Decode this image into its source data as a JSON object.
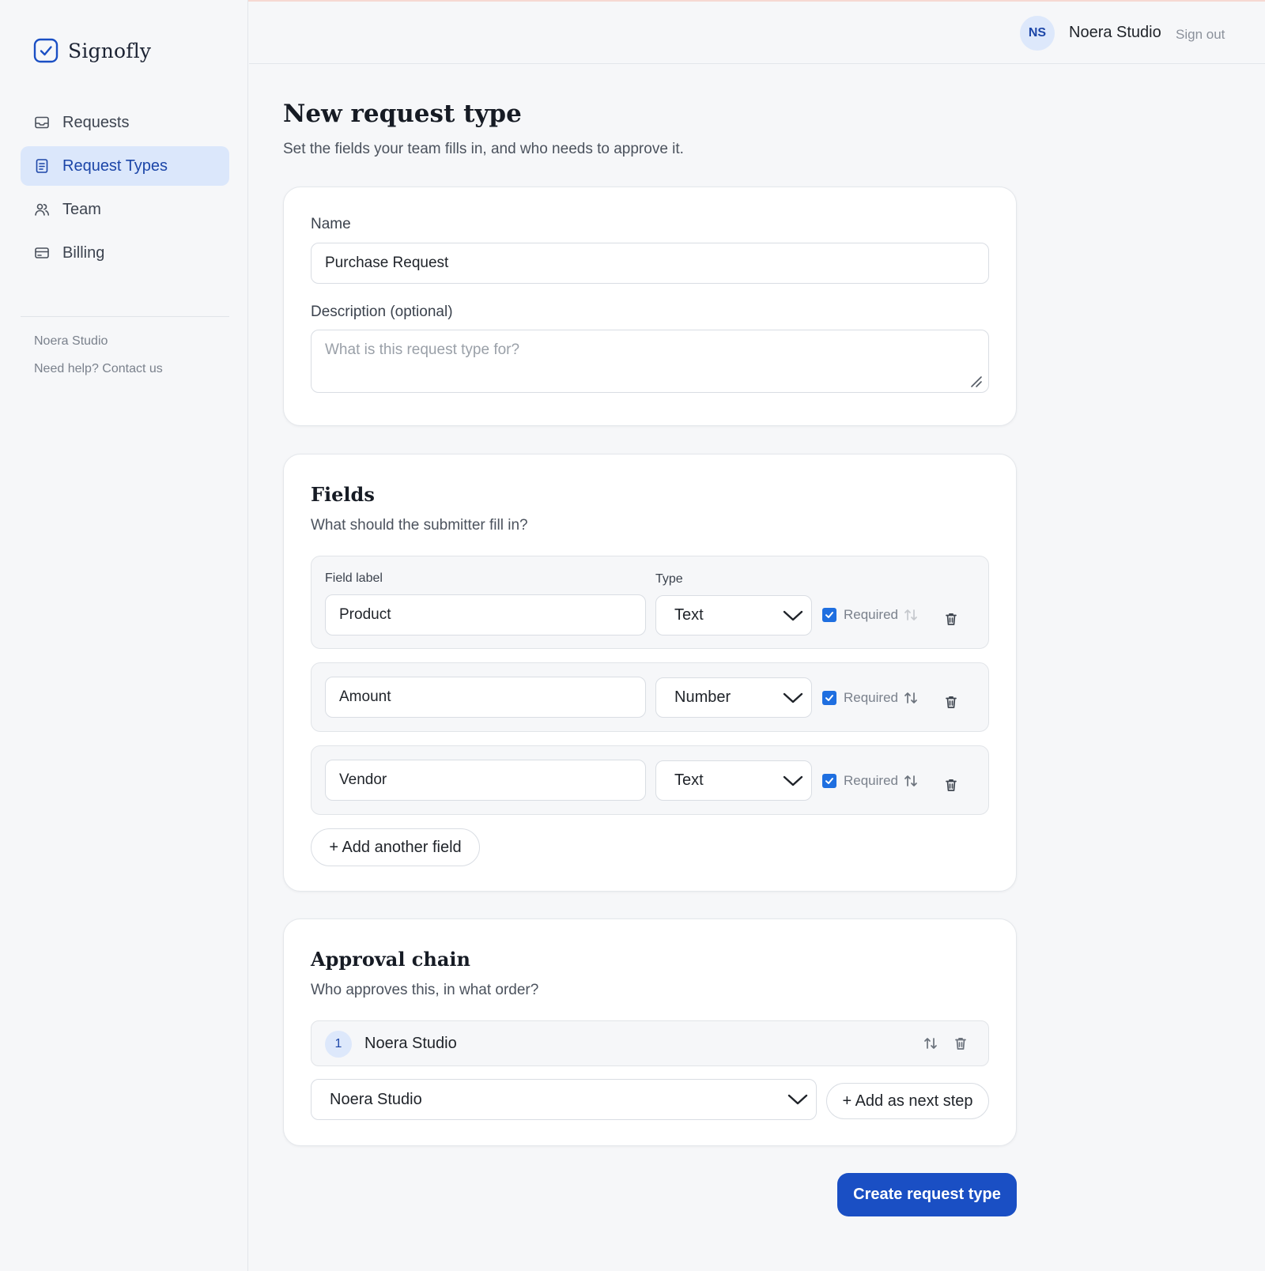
{
  "app": {
    "name": "Signofly"
  },
  "sidebar": {
    "items": [
      {
        "label": "Requests",
        "icon": "inbox-icon",
        "active": false
      },
      {
        "label": "Request Types",
        "icon": "document-icon",
        "active": true
      },
      {
        "label": "Team",
        "icon": "users-icon",
        "active": false
      },
      {
        "label": "Billing",
        "icon": "credit-card-icon",
        "active": false
      }
    ],
    "workspace": "Noera Studio",
    "help": "Need help? Contact us"
  },
  "topbar": {
    "avatar_initials": "NS",
    "user_name": "Noera Studio",
    "signout": "Sign out"
  },
  "page": {
    "title": "New request type",
    "subtitle": "Set the fields your team fills in, and who needs to approve it."
  },
  "details": {
    "name_label": "Name",
    "name_value": "Purchase Request",
    "description_label": "Description (optional)",
    "description_placeholder": "What is this request type for?"
  },
  "fields": {
    "title": "Fields",
    "subtitle": "What should the submitter fill in?",
    "col_label": "Field label",
    "col_type": "Type",
    "required_label": "Required",
    "rows": [
      {
        "label": "Product",
        "type": "Text",
        "required": true
      },
      {
        "label": "Amount",
        "type": "Number",
        "required": true
      },
      {
        "label": "Vendor",
        "type": "Text",
        "required": true
      }
    ],
    "add_button": "+ Add another field"
  },
  "approval": {
    "title": "Approval chain",
    "subtitle": "Who approves this, in what order?",
    "steps": [
      {
        "number": "1",
        "name": "Noera Studio"
      }
    ],
    "select_value": "Noera Studio",
    "add_button": "+ Add as next step"
  },
  "actions": {
    "create": "Create request type"
  },
  "colors": {
    "accent": "#1a4fc4",
    "active_bg": "#dbe7fb",
    "checkbox": "#1f6fe0"
  }
}
